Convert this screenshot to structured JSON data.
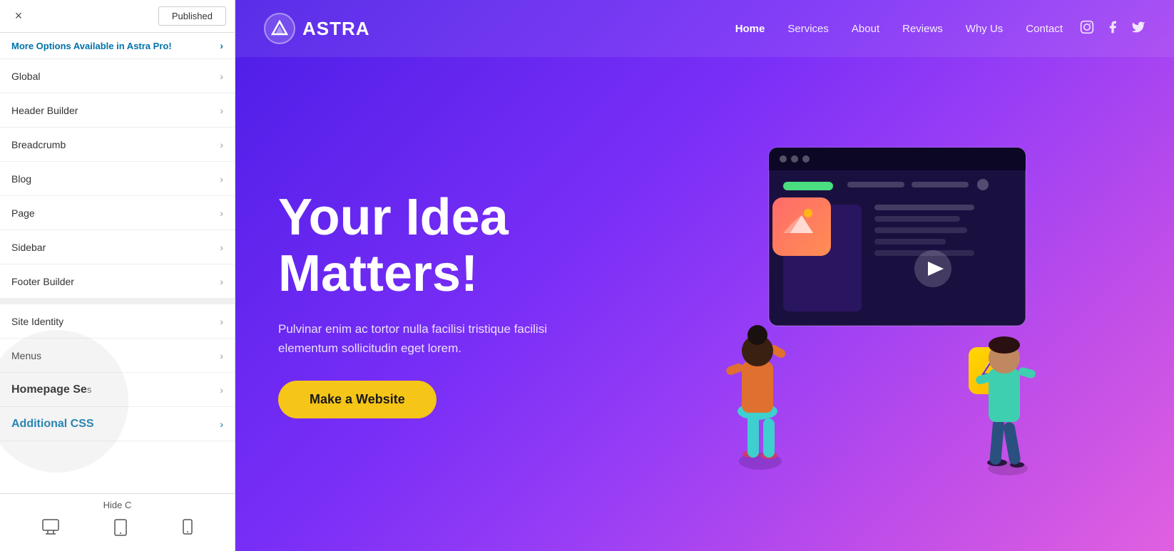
{
  "topbar": {
    "close_label": "×",
    "published_label": "Published"
  },
  "promo": {
    "label": "More Options Available in Astra Pro!",
    "chevron": "›"
  },
  "menu": {
    "items": [
      {
        "label": "Global",
        "id": "global"
      },
      {
        "label": "Header Builder",
        "id": "header-builder"
      },
      {
        "label": "Breadcrumb",
        "id": "breadcrumb"
      },
      {
        "label": "Blog",
        "id": "blog"
      },
      {
        "label": "Page",
        "id": "page"
      },
      {
        "label": "Sidebar",
        "id": "sidebar"
      },
      {
        "label": "Footer Builder",
        "id": "footer-builder"
      },
      {
        "label": "Site Identity",
        "id": "site-identity"
      },
      {
        "label": "Menus",
        "id": "menus"
      }
    ],
    "chevron": "›"
  },
  "homepage_section": {
    "label": "Homepage Se",
    "sublabel": "s",
    "chevron": "›"
  },
  "additional_css": {
    "label": "Additional CSS",
    "chevron": "›"
  },
  "bottom_bar": {
    "hide_label": "Hide C",
    "device_desktop": "🖥",
    "device_tablet": "📱",
    "device_mobile": "📱"
  },
  "nav": {
    "logo_icon": "▲",
    "logo_text": "ASTRA",
    "links": [
      {
        "label": "Home",
        "active": true
      },
      {
        "label": "Services",
        "active": false
      },
      {
        "label": "About",
        "active": false
      },
      {
        "label": "Reviews",
        "active": false
      },
      {
        "label": "Why Us",
        "active": false
      },
      {
        "label": "Contact",
        "active": false
      }
    ],
    "social_icons": [
      "instagram",
      "facebook",
      "twitter"
    ]
  },
  "hero": {
    "title_line1": "Your Idea",
    "title_line2": "Matters!",
    "subtitle": "Pulvinar enim ac tortor nulla facilisi tristique facilisi elementum sollicitudin eget lorem.",
    "cta_label": "Make a Website"
  },
  "colors": {
    "bg_start": "#4c1de7",
    "bg_end": "#e060e0",
    "cta_bg": "#f5c518",
    "accent_green": "#4ade80"
  }
}
